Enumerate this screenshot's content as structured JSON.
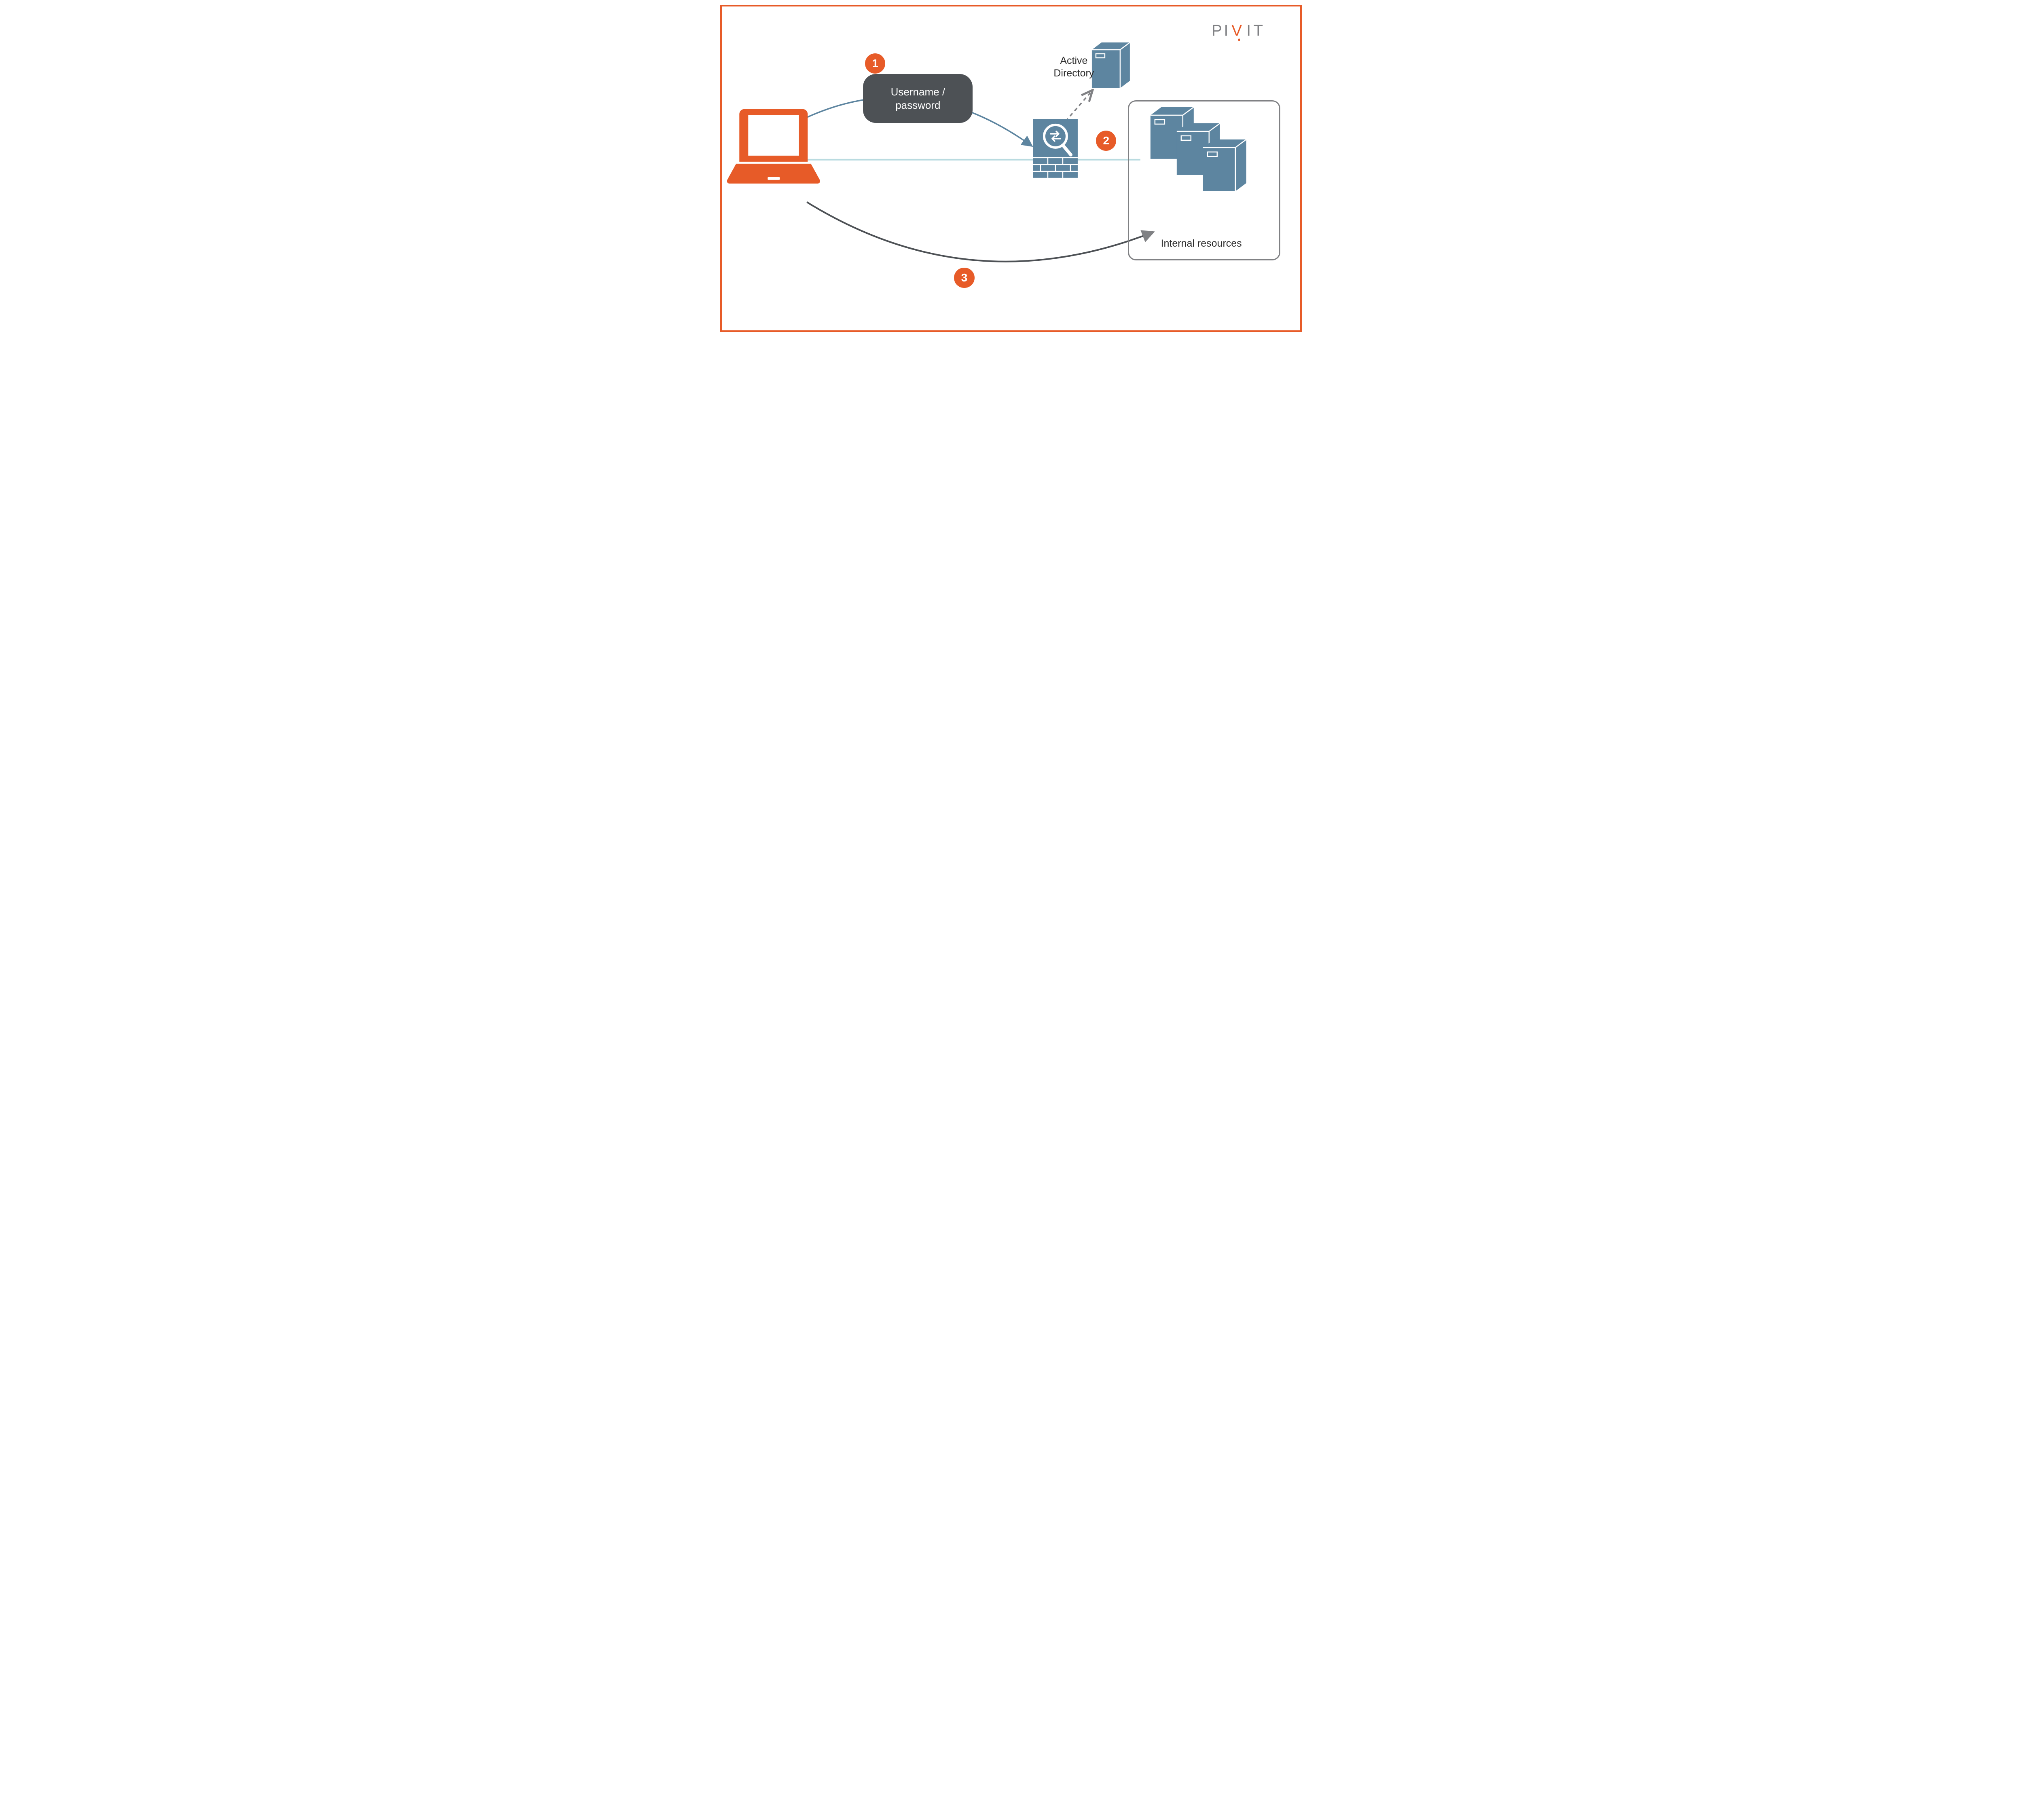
{
  "brand": {
    "name": "PIVIT"
  },
  "steps": {
    "1": {
      "number": "1",
      "label_line1": "Username /",
      "label_line2": "password"
    },
    "2": {
      "number": "2"
    },
    "3": {
      "number": "3"
    }
  },
  "nodes": {
    "laptop": {
      "name": "laptop",
      "color": "#e75b28"
    },
    "firewall": {
      "name": "firewall",
      "icon": "inspect"
    },
    "active_directory": {
      "label": "Active\nDirectory"
    },
    "internal_resources": {
      "label": "Internal resources"
    }
  },
  "connections": [
    {
      "from": "laptop",
      "to": "firewall",
      "style": "solid-arrow",
      "step": 1
    },
    {
      "from": "firewall",
      "to": "active_directory",
      "style": "dashed-arrow",
      "step": 2
    },
    {
      "from": "laptop",
      "to": "internal_resources",
      "style": "link",
      "direct": true
    },
    {
      "from": "laptop",
      "to": "internal_resources",
      "style": "solid-arrow",
      "step": 3
    }
  ],
  "labels": {
    "active_directory_line1": "Active",
    "active_directory_line2": "Directory",
    "internal_resources": "Internal resources"
  }
}
